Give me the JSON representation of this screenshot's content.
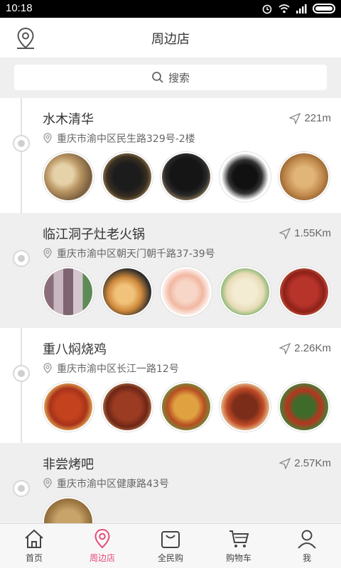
{
  "status": {
    "time": "10:18"
  },
  "header": {
    "title": "周边店",
    "location_icon": "location-pin-icon"
  },
  "search": {
    "label": "搜索",
    "icon": "search-icon"
  },
  "colors": {
    "accent": "#e84a7a",
    "alt_row": "#efefef"
  },
  "stores": [
    {
      "name": "水木清华",
      "distance": "221m",
      "address": "重庆市渝中区民生路329号-2楼",
      "photos": [
        "dried-mushroom",
        "black-beans",
        "black-beans-bowl",
        "black-beans-plate",
        "ginseng-roots"
      ]
    },
    {
      "name": "临江洞子灶老火锅",
      "distance": "1.55Km",
      "address": "重庆市渝中区朝天门朝千路37-39号",
      "photos": [
        "sliced-meat",
        "shrimp-rolls",
        "sliced-fish",
        "tofu-skin",
        "sausage"
      ]
    },
    {
      "name": "重八焖烧鸡",
      "distance": "2.26Km",
      "address": "重庆市渝中区长江一路12号",
      "photos": [
        "spicy-chicken",
        "braised-chicken",
        "chicken-platter",
        "chili-chicken",
        "pepper-chicken"
      ]
    },
    {
      "name": "非尝烤吧",
      "distance": "2.57Km",
      "address": "重庆市渝中区健康路43号",
      "photos": [
        "bbq-fish"
      ]
    }
  ],
  "nav": [
    {
      "label": "首页",
      "icon": "home-icon",
      "active": false
    },
    {
      "label": "周边店",
      "icon": "location-pin-icon",
      "active": true
    },
    {
      "label": "全民购",
      "icon": "shopping-bag-icon",
      "active": false
    },
    {
      "label": "购物车",
      "icon": "cart-icon",
      "active": false
    },
    {
      "label": "我",
      "icon": "user-icon",
      "active": false
    }
  ]
}
